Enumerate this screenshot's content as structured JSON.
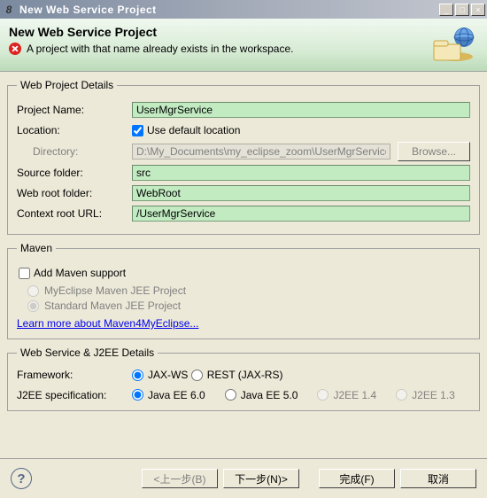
{
  "window": {
    "title": "New Web Service Project"
  },
  "banner": {
    "heading": "New Web Service Project",
    "error_msg": "A project with that name already exists in the workspace."
  },
  "details": {
    "legend": "Web Project Details",
    "project_name_label": "Project Name:",
    "project_name_value": "UserMgrService",
    "location_label": "Location:",
    "use_default_location_label": "Use default location",
    "use_default_location_checked": true,
    "directory_label": "Directory:",
    "directory_value": "D:\\My_Documents\\my_eclipse_zoom\\UserMgrService",
    "browse_label": "Browse...",
    "source_folder_label": "Source folder:",
    "source_folder_value": "src",
    "web_root_label": "Web root folder:",
    "web_root_value": "WebRoot",
    "context_root_label": "Context root URL:",
    "context_root_value": "/UserMgrService"
  },
  "maven": {
    "legend": "Maven",
    "add_support_label": "Add Maven support",
    "myeclipse_label": "MyEclipse Maven JEE Project",
    "standard_label": "Standard Maven JEE Project",
    "link_label": "Learn more about Maven4MyEclipse..."
  },
  "ws": {
    "legend": "Web Service & J2EE Details",
    "framework_label": "Framework:",
    "fw_jaxws": "JAX-WS",
    "fw_rest": "REST (JAX-RS)",
    "j2ee_label": "J2EE specification:",
    "j2ee_ee6": "Java EE 6.0",
    "j2ee_ee5": "Java EE 5.0",
    "j2ee_14": "J2EE 1.4",
    "j2ee_13": "J2EE 1.3"
  },
  "footer": {
    "back": "<上一步(B)",
    "next": "下一步(N)>",
    "finish": "完成(F)",
    "cancel": "取消"
  }
}
